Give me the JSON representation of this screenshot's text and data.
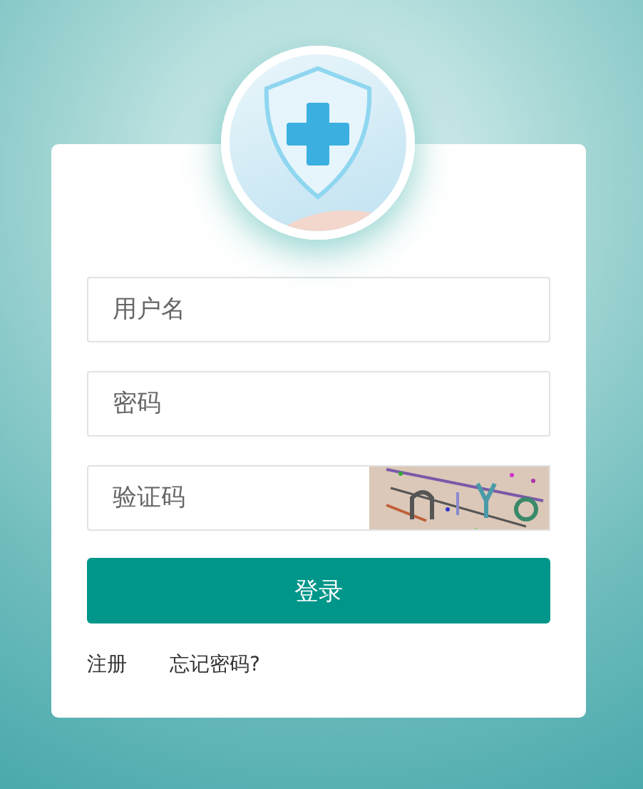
{
  "login_form": {
    "fields": [
      {
        "kind": "text",
        "placeholder": "用户名"
      },
      {
        "kind": "password",
        "placeholder": "密码"
      },
      {
        "kind": "captcha",
        "placeholder": "验证码"
      }
    ],
    "submit_button": "登录",
    "links": [
      "注册",
      "忘记密码?"
    ]
  }
}
